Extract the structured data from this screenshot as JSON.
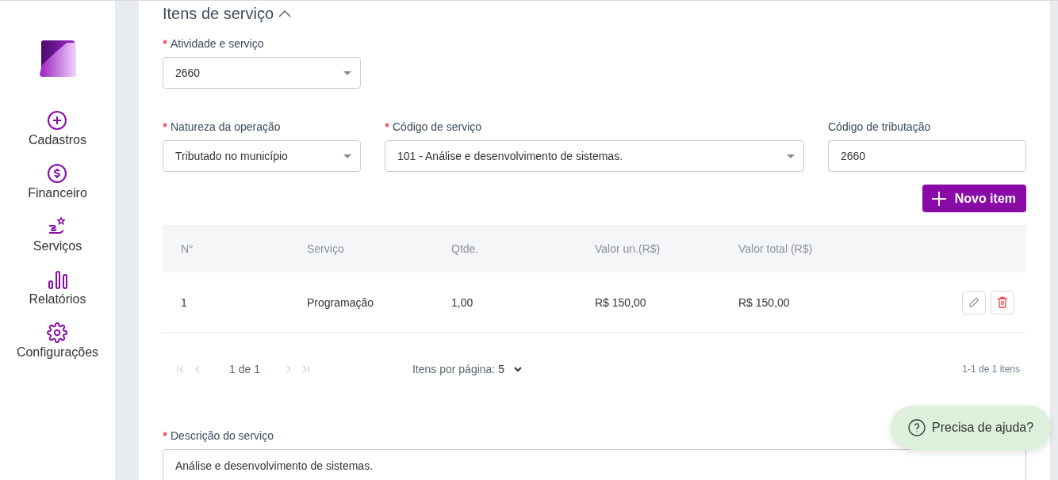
{
  "sidebar": {
    "items": [
      {
        "label": "Cadastros"
      },
      {
        "label": "Financeiro"
      },
      {
        "label": "Serviços"
      },
      {
        "label": "Relatórios"
      },
      {
        "label": "Configurações"
      }
    ]
  },
  "section": {
    "title": "Itens de serviço",
    "expanded": true
  },
  "fields": [
    {
      "label": "Atividade e serviço",
      "required": true,
      "kind": "select",
      "value": "2660"
    },
    {
      "label": "Natureza da operação",
      "required": true,
      "kind": "select",
      "value": "Tributado no município"
    },
    {
      "label": "Código de serviço",
      "required": true,
      "kind": "select",
      "value": "101 - Análise e desenvolvimento de sistemas."
    },
    {
      "label": "Código de tributação",
      "required": false,
      "kind": "input",
      "value": "2660"
    }
  ],
  "new_item_button": "Novo item",
  "table": {
    "columns": [
      "N°",
      "Serviço",
      "Qtde.",
      "Valor un.(R$)",
      "Valor total (R$)"
    ],
    "rows": [
      {
        "cells": [
          "1",
          "Programação",
          "1,00",
          "R$ 150,00",
          "R$ 150,00"
        ]
      }
    ]
  },
  "pagination": {
    "page": "1 de 1",
    "per_page_label": "Itens por página:",
    "per_page": "5",
    "summary": "1-1 de 1 itens"
  },
  "description": {
    "label": "Descrição do serviço",
    "required": true,
    "value": "Análise e desenvolvimento de sistemas."
  },
  "help_button": "Precisa de ajuda?"
}
